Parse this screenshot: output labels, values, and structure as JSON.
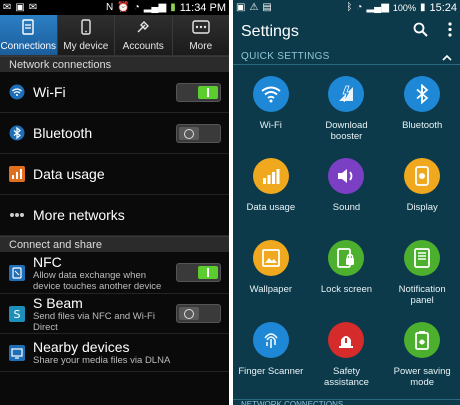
{
  "left": {
    "status": {
      "time": "11:34 PM",
      "battery": "100%"
    },
    "tabs": [
      {
        "label": "Connections",
        "icon": "connections-icon"
      },
      {
        "label": "My device",
        "icon": "device-icon"
      },
      {
        "label": "Accounts",
        "icon": "accounts-icon"
      },
      {
        "label": "More",
        "icon": "more-icon"
      }
    ],
    "section1": "Network connections",
    "wifi": "Wi-Fi",
    "bluetooth": "Bluetooth",
    "data_usage": "Data usage",
    "more_networks": "More networks",
    "section2": "Connect and share",
    "nfc": {
      "title": "NFC",
      "sub1": "Allow data exchange when",
      "sub2": "device touches another device"
    },
    "sbeam": {
      "title": "S Beam",
      "sub1": "Send files via NFC and Wi-Fi",
      "sub2": "Direct"
    },
    "nearby": {
      "title": "Nearby devices",
      "sub1": "Share your media files via DLNA"
    }
  },
  "right": {
    "status": {
      "battery": "100%",
      "time": "15:24"
    },
    "title": "Settings",
    "quick_header": "QUICK SETTINGS",
    "tiles": [
      {
        "label": "Wi-Fi",
        "label2": "",
        "color": "#1e88d6"
      },
      {
        "label": "Download",
        "label2": "booster",
        "color": "#1e88d6"
      },
      {
        "label": "Bluetooth",
        "label2": "",
        "color": "#1e88d6"
      },
      {
        "label": "Data usage",
        "label2": "",
        "color": "#f0a81e"
      },
      {
        "label": "Sound",
        "label2": "",
        "color": "#7b3fc4"
      },
      {
        "label": "Display",
        "label2": "",
        "color": "#f0a81e"
      },
      {
        "label": "Wallpaper",
        "label2": "",
        "color": "#f0a81e"
      },
      {
        "label": "Lock screen",
        "label2": "",
        "color": "#4caf2e"
      },
      {
        "label": "Notification",
        "label2": "panel",
        "color": "#4caf2e"
      },
      {
        "label": "Finger Scanner",
        "label2": "",
        "color": "#1e88d6"
      },
      {
        "label": "Safety",
        "label2": "assistance",
        "color": "#d62b2b"
      },
      {
        "label": "Power saving",
        "label2": "mode",
        "color": "#4caf2e"
      }
    ],
    "footer": "NETWORK CONNECTIONS"
  }
}
